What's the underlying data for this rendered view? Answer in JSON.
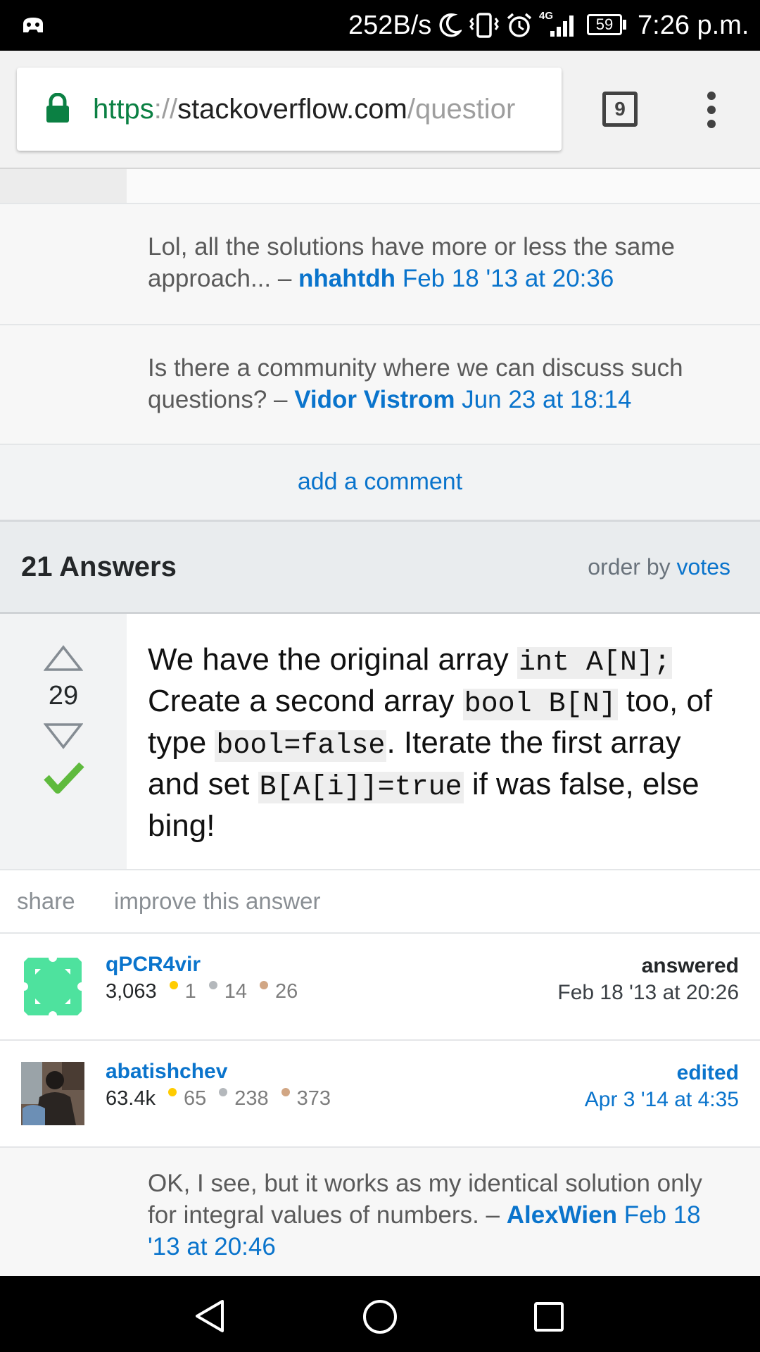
{
  "status_bar": {
    "speed": "252B/s",
    "network": "4G",
    "battery": "59",
    "time": "7:26 p.m."
  },
  "browser": {
    "url_scheme": "https",
    "url_sep": "://",
    "url_host": "stackoverflow.com",
    "url_path": "/questior",
    "tab_count": "9"
  },
  "comments": [
    {
      "text": "Lol, all the solutions have more or less the same approach... –",
      "user": "nhahtdh",
      "date": "Feb 18 '13 at 20:36"
    },
    {
      "text": "Is there a community where we can discuss such questions? –",
      "user": "Vidor Vistrom",
      "date": "Jun 23 at 18:14"
    }
  ],
  "add_comment": "add a comment",
  "answers_header": {
    "count": "21 Answers",
    "order_prefix": "order by",
    "order_value": "votes"
  },
  "answer": {
    "votes": "29",
    "parts": [
      "We have the original array ",
      "int A[N];",
      " Create a second array ",
      "bool B[N]",
      " too, of type ",
      "bool=false",
      ". Iterate the first array and set ",
      "B[A[i]]=true",
      " if was false, else bing!"
    ],
    "share": "share",
    "improve": "improve this answer"
  },
  "answerer": {
    "name": "qPCR4vir",
    "rep": "3,063",
    "gold": "1",
    "silver": "14",
    "bronze": "26",
    "label": "answered",
    "date": "Feb 18 '13 at 20:26"
  },
  "editor": {
    "name": "abatishchev",
    "rep": "63.4k",
    "gold": "65",
    "silver": "238",
    "bronze": "373",
    "label": "edited",
    "date": "Apr 3 '14 at 4:35"
  },
  "answer_comment": {
    "text": "OK, I see, but it works as my identical solution only for integral values of numbers. –",
    "user": "AlexWien",
    "date": "Feb 18 '13 at 20:46"
  },
  "colors": {
    "link": "#0a74cc",
    "accepted": "#5fba3d",
    "gold": "#ffcc01",
    "silver": "#b4b8bc",
    "bronze": "#d1a684"
  }
}
